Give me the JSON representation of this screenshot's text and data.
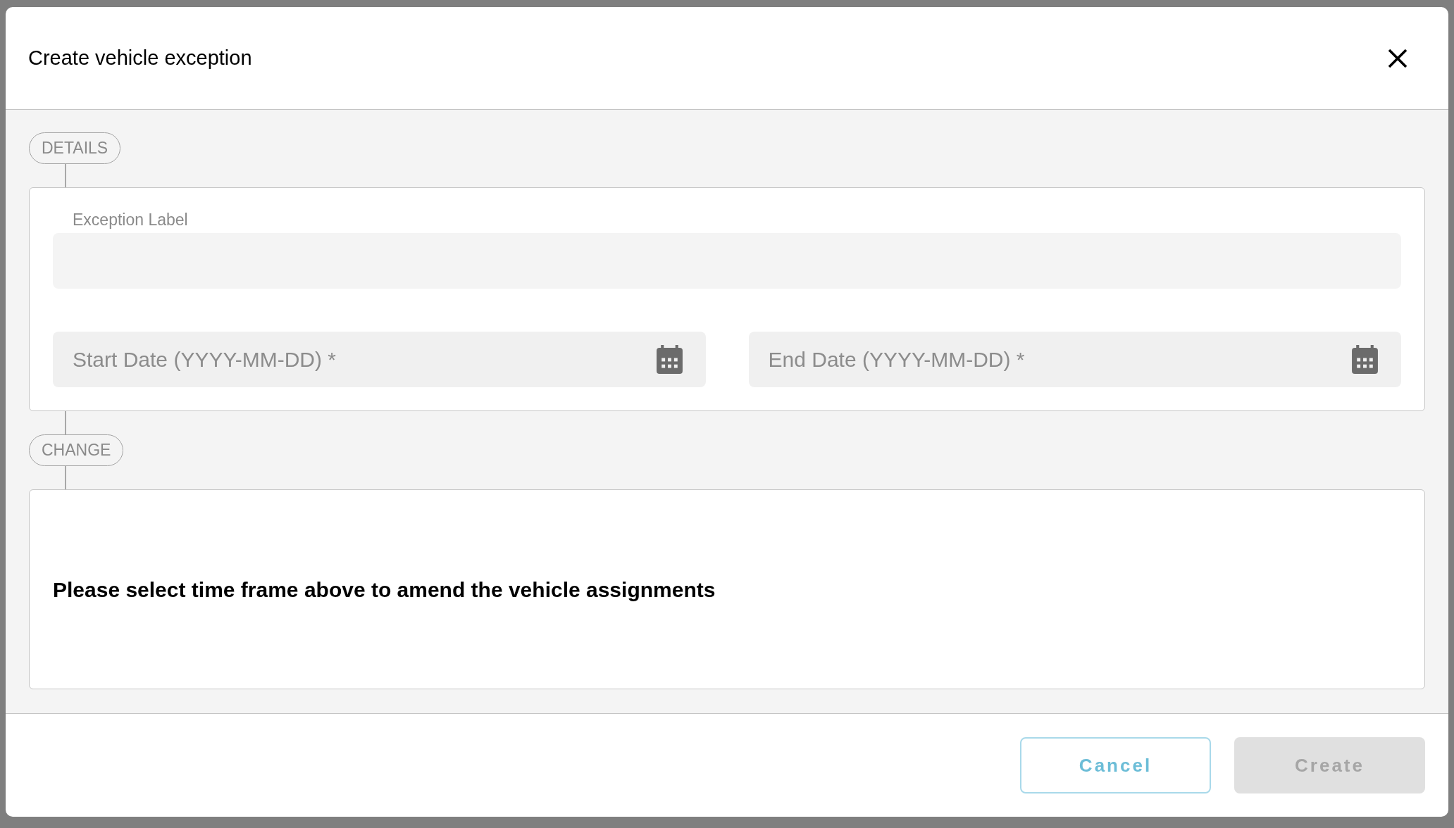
{
  "dialog": {
    "title": "Create vehicle exception"
  },
  "sections": [
    {
      "kind": "form",
      "title": "DETAILS",
      "label_field": {
        "label": "Exception Label"
      },
      "date_fields": [
        {
          "placeholder": "Start Date (YYYY-MM-DD) *"
        },
        {
          "placeholder": "End Date (YYYY-MM-DD) *"
        }
      ]
    },
    {
      "kind": "message",
      "title": "CHANGE",
      "message": "Please select time frame above to amend the vehicle assignments"
    }
  ],
  "buttons": [
    {
      "label": "Cancel",
      "kind": "outline",
      "disabled": false
    },
    {
      "label": "Create",
      "kind": "filled",
      "disabled": true
    }
  ]
}
